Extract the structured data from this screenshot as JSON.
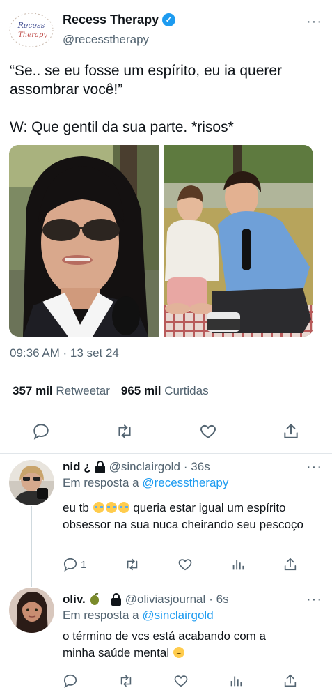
{
  "tweet": {
    "author_name": "Recess Therapy",
    "author_handle": "@recesstherapy",
    "avatar_text_line1": "Recess",
    "avatar_text_line2": "Therapy",
    "more": "···",
    "text": "“Se.. se eu fosse um espírito, eu ia querer assombrar você!”\n\nW: Que gentil da sua parte. *risos*",
    "timestamp": "09:36 AM · 13 set 24",
    "retweets_count": "357 mil",
    "retweets_label": "Retweetar",
    "likes_count": "965 mil",
    "likes_label": "Curtidas"
  },
  "replies": [
    {
      "name": "nid ¿",
      "handle": "@sinclairgold",
      "time": "· 36s",
      "reply_prefix": "Em resposta a",
      "reply_to": "@recesstherapy",
      "text_before": "eu tb",
      "text_after": " queria estar igual um espírito obsessor na sua nuca cheirando seu pescoço",
      "reply_count": "1",
      "more": "···"
    },
    {
      "name": "oliv.",
      "handle": "@oliviasjournal",
      "time": "· 6s",
      "reply_prefix": "Em resposta a",
      "reply_to": "@sinclairgold",
      "text": "o término de vcs está acabando com a minha saúde mental",
      "more": "···"
    }
  ],
  "colors": {
    "accent": "#1d9bf0",
    "muted": "#536471",
    "text": "#0f1419"
  }
}
